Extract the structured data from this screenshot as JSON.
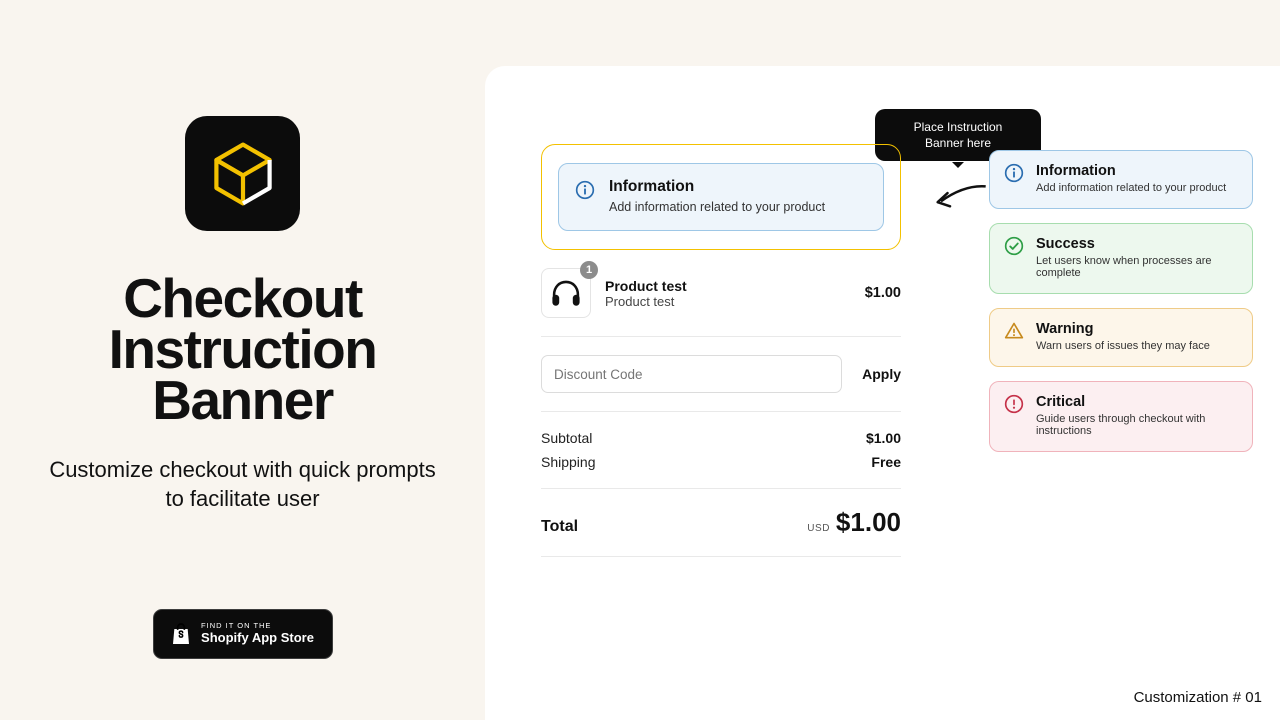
{
  "left": {
    "title_line1": "Checkout",
    "title_line2": "Instruction",
    "title_line3": "Banner",
    "subtitle": "Customize checkout with quick prompts to facilitate user",
    "badge_line1": "FIND IT ON THE",
    "badge_line2": "Shopify App Store"
  },
  "tooltip": "Place Instruction Banner here",
  "banner": {
    "title": "Information",
    "desc": "Add information related to your product"
  },
  "line_item": {
    "name": "Product test",
    "variant": "Product test",
    "qty": "1",
    "price": "$1.00"
  },
  "coupon": {
    "placeholder": "Discount Code",
    "apply": "Apply"
  },
  "summary": {
    "subtotal_label": "Subtotal",
    "subtotal_value": "$1.00",
    "shipping_label": "Shipping",
    "shipping_value": "Free",
    "total_label": "Total",
    "currency": "USD",
    "total_value": "$1.00"
  },
  "options": {
    "info": {
      "title": "Information",
      "desc": "Add information related to your product"
    },
    "success": {
      "title": "Success",
      "desc": "Let users know when processes are complete"
    },
    "warning": {
      "title": "Warning",
      "desc": "Warn users of issues they may face"
    },
    "critical": {
      "title": "Critical",
      "desc": "Guide users through checkout with instructions"
    }
  },
  "footer_tag": "Customization # 01"
}
